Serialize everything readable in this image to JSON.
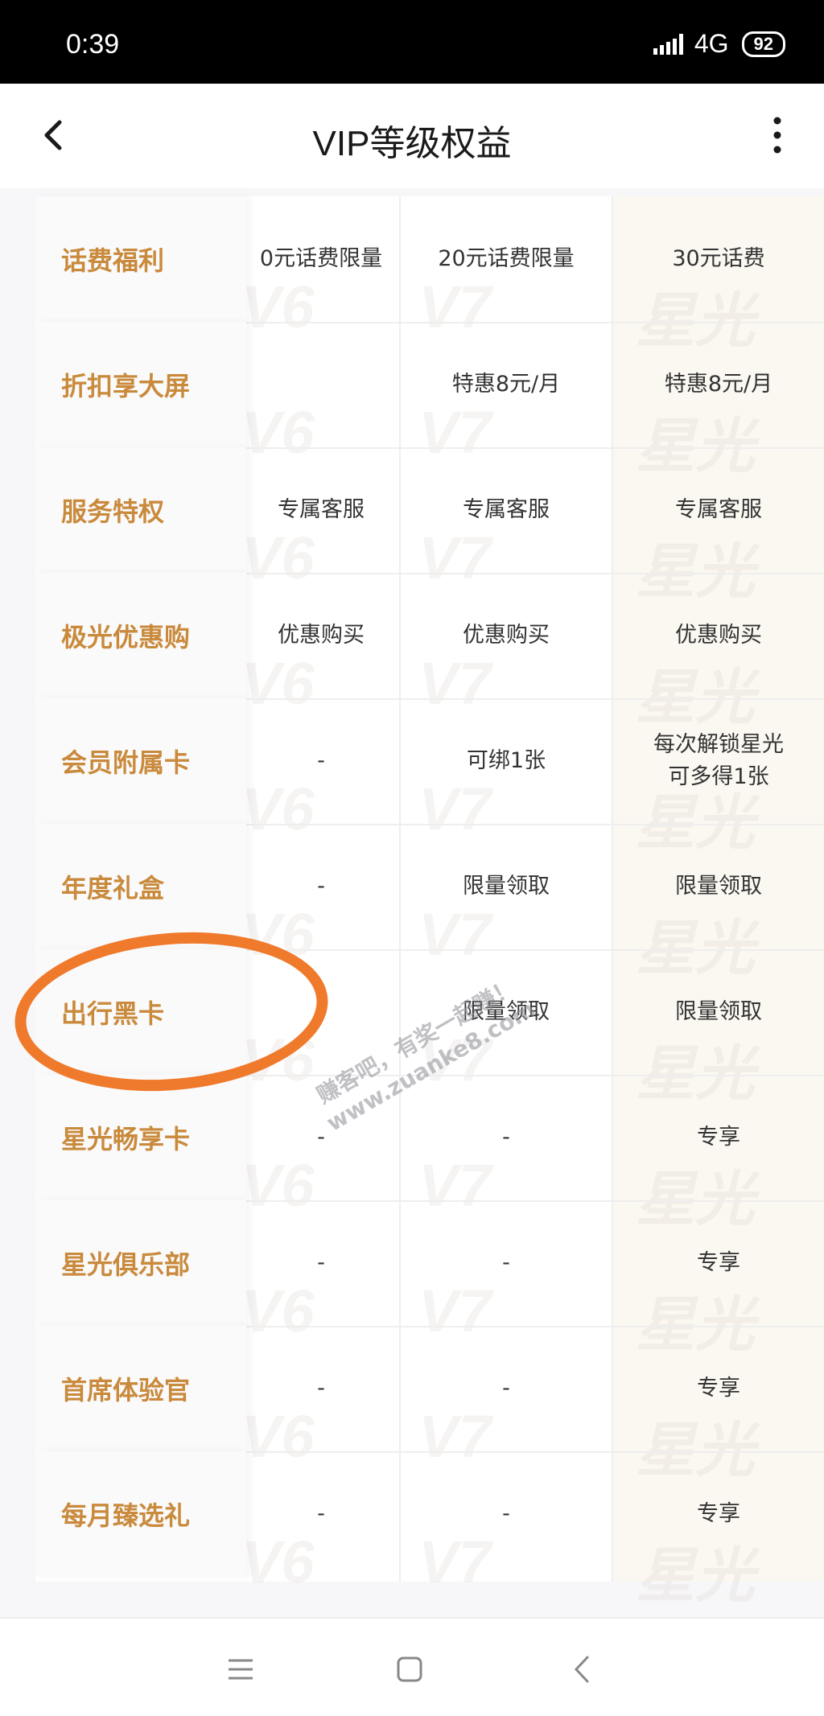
{
  "status_bar": {
    "time": "0:39",
    "network": "4G",
    "battery": "92"
  },
  "header": {
    "title": "VIP等级权益"
  },
  "column_watermarks": [
    "V6",
    "V7",
    "星光"
  ],
  "rows": [
    {
      "label": "话费福利",
      "v6": "0元话费限量",
      "v7": "20元话费限量",
      "star": "30元话费"
    },
    {
      "label": "折扣享大屏",
      "v6": "",
      "v7": "特惠8元/月",
      "star": "特惠8元/月"
    },
    {
      "label": "服务特权",
      "v6": "专属客服",
      "v7": "专属客服",
      "star": "专属客服"
    },
    {
      "label": "极光优惠购",
      "v6": "优惠购买",
      "v7": "优惠购买",
      "star": "优惠购买"
    },
    {
      "label": "会员附属卡",
      "v6": "-",
      "v7": "可绑1张",
      "star": "每次解锁星光\n可多得1张"
    },
    {
      "label": "年度礼盒",
      "v6": "-",
      "v7": "限量领取",
      "star": "限量领取"
    },
    {
      "label": "出行黑卡",
      "v6": "-",
      "v7": "限量领取",
      "star": "限量领取"
    },
    {
      "label": "星光畅享卡",
      "v6": "-",
      "v7": "-",
      "star": "专享"
    },
    {
      "label": "星光俱乐部",
      "v6": "-",
      "v7": "-",
      "star": "专享"
    },
    {
      "label": "首席体验官",
      "v6": "-",
      "v7": "-",
      "star": "专享"
    },
    {
      "label": "每月臻选礼",
      "v6": "-",
      "v7": "-",
      "star": "专享"
    }
  ],
  "watermark_text": {
    "line1": "赚客吧，有奖一起赚！",
    "line2": "www.zuanke8.com"
  },
  "colors": {
    "label": "#c98a3c",
    "highlight_circle": "#f07a2c",
    "star_column_bg": "#fbf8f2"
  }
}
